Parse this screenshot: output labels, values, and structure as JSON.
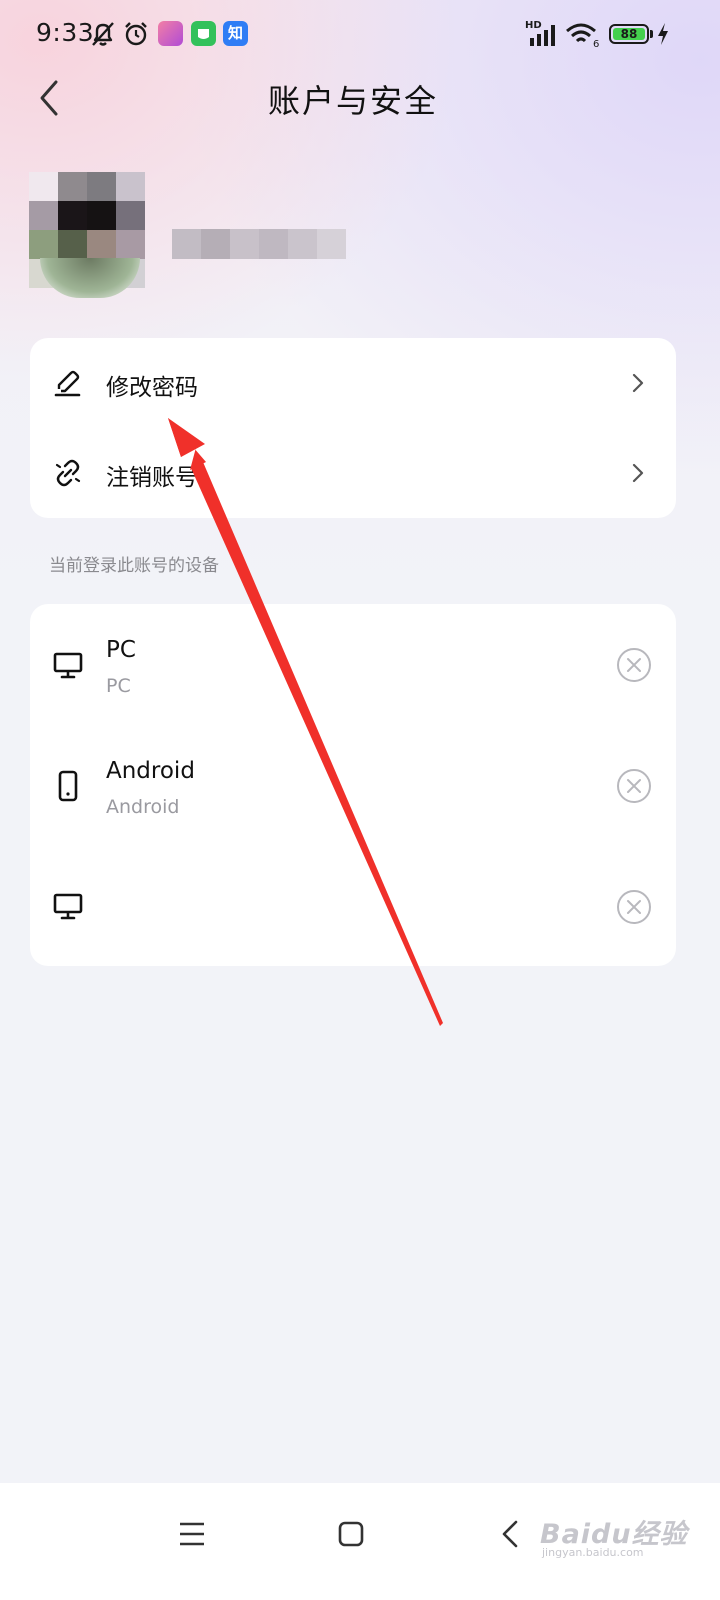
{
  "status_bar": {
    "time": "9:33",
    "app_badge_zhihu": "知",
    "hd_label": "HD",
    "battery_level": "88",
    "icons": [
      "mute-bell-icon",
      "alarm-icon",
      "app-icon",
      "app-icon",
      "zhihu-icon",
      "signal-icon",
      "wifi-icon",
      "battery-icon",
      "charging-icon"
    ]
  },
  "header": {
    "title": "账户与安全",
    "back_icon": "chevron-left-icon"
  },
  "account_actions": [
    {
      "label": "修改密码",
      "icon": "edit-pencil-icon"
    },
    {
      "label": "注销账号",
      "icon": "unlink-icon"
    }
  ],
  "devices_section": {
    "label": "当前登录此账号的设备",
    "devices": [
      {
        "name": "PC",
        "subtitle": "PC",
        "icon": "monitor-icon"
      },
      {
        "name": "Android",
        "subtitle": "Android",
        "icon": "phone-icon"
      },
      {
        "name": "",
        "subtitle": "",
        "icon": "monitor-icon"
      }
    ]
  },
  "nav_bar": {
    "icons": [
      "menu-icon",
      "home-square-icon",
      "back-triangle-icon"
    ]
  },
  "watermark": {
    "main": "Baidu经验",
    "sub": "jingyan.baidu.com"
  },
  "colors": {
    "annotation_arrow": "#f0302a",
    "battery_fill": "#44d04e",
    "background": "#f2f3f8"
  }
}
